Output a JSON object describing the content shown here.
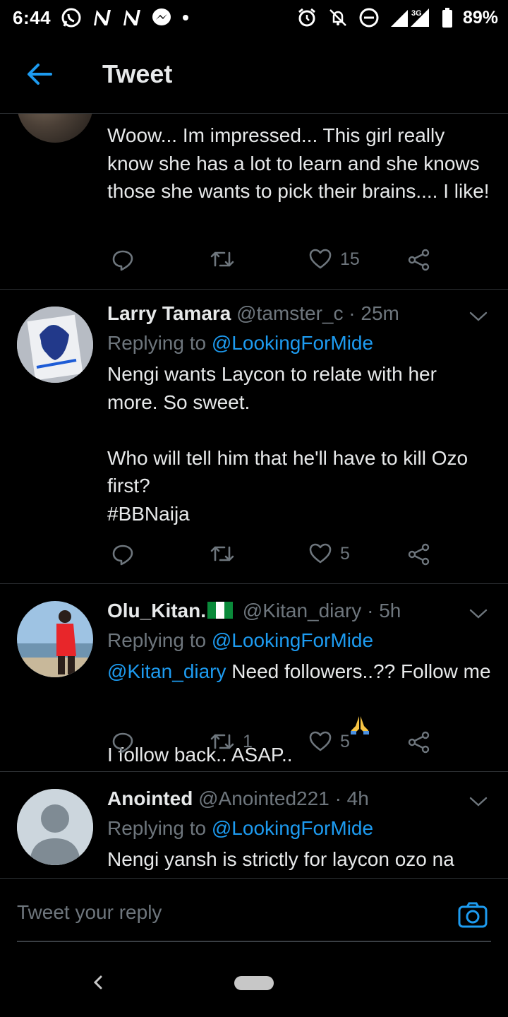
{
  "status_bar": {
    "time": "6:44",
    "battery": "89%",
    "network": "3G",
    "left_icons": [
      "whatsapp-icon",
      "n-app-icon",
      "n-app-icon",
      "messenger-icon",
      "dot-icon"
    ],
    "right_icons": [
      "alarm-icon",
      "bell-off-icon",
      "dnd-icon",
      "signal-icon",
      "battery-icon"
    ]
  },
  "header": {
    "title": "Tweet"
  },
  "colors": {
    "background": "#000000",
    "accent": "#1d9bf0",
    "text": "#e7e9ea",
    "muted": "#6e767d",
    "divider": "#2f3336"
  },
  "tweets": [
    {
      "text": "Woow... Im impressed... This girl really know she has a lot to learn and she knows those she wants to pick their brains.... I like!",
      "likes": "15"
    },
    {
      "name": "Larry Tamara",
      "handle": "@tamster_c",
      "time": "· 25m",
      "replying_prefix": "Replying to",
      "replying_to": "@LookingForMide",
      "text": "Nengi wants Laycon to relate with her more. So sweet.\n\nWho will tell him that he'll have to kill Ozo first?",
      "hashtag": "#BBNaija",
      "likes": "5"
    },
    {
      "name": "Olu_Kitan.",
      "handle": "@Kitan_diary",
      "time": "· 5h",
      "replying_prefix": "Replying to",
      "replying_to": "@LookingForMide",
      "mention": "@Kitan_diary",
      "text": " Need followers..?? Follow me I follow back.. ASAP..",
      "retweets": "1",
      "likes": "5"
    },
    {
      "name": "Anointed",
      "handle": "@Anointed221",
      "time": "· 4h",
      "replying_prefix": "Replying to",
      "replying_to": "@LookingForMide",
      "text": "Nengi yansh is strictly for laycon ozo na"
    }
  ],
  "reply_bar": {
    "placeholder": "Tweet your reply"
  }
}
